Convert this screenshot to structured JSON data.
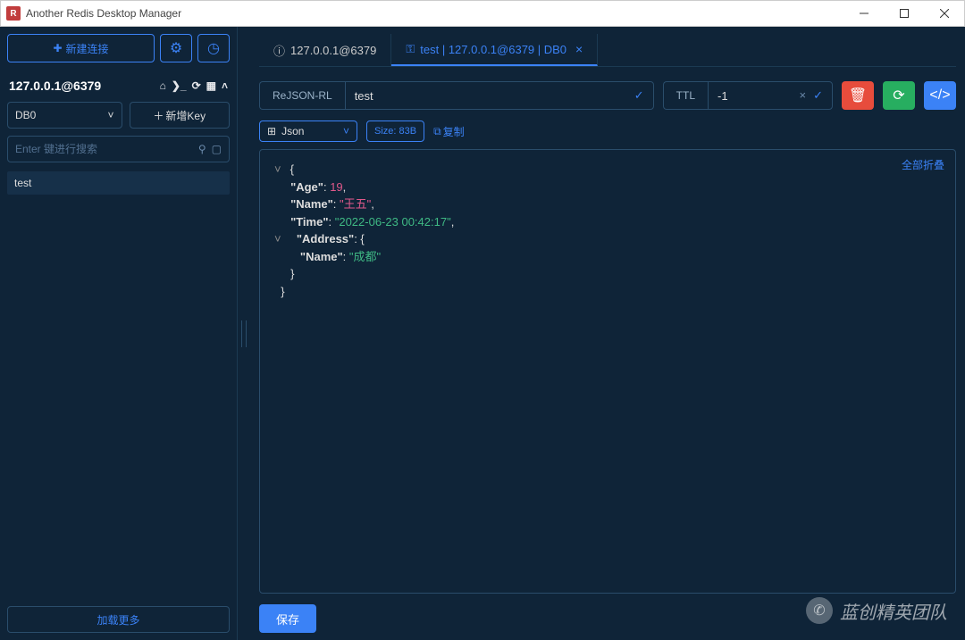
{
  "window": {
    "title": "Another Redis Desktop Manager"
  },
  "sidebar": {
    "newConnection": "新建连接",
    "connectionName": "127.0.0.1@6379",
    "dbSelected": "DB0",
    "addKey": "新增Key",
    "searchPlaceholder": "Enter 键进行搜索",
    "keys": [
      "test"
    ],
    "loadMore": "加载更多"
  },
  "tabs": [
    {
      "label": "127.0.0.1@6379",
      "active": false,
      "icon": "info"
    },
    {
      "label": "test | 127.0.0.1@6379 | DB0",
      "active": true,
      "icon": "key"
    }
  ],
  "keyDetail": {
    "type": "ReJSON-RL",
    "name": "test",
    "ttlLabel": "TTL",
    "ttlValue": "-1",
    "viewMode": "Json",
    "sizeLabel": "Size: 83B",
    "copyLabel": "复制",
    "collapseAll": "全部折叠",
    "saveLabel": "保存"
  },
  "jsonValue": {
    "Age": 19,
    "Name": "王五",
    "Time": "2022-06-23 00:42:17",
    "Address": {
      "Name": "成都"
    }
  },
  "watermark": "蓝创精英团队"
}
